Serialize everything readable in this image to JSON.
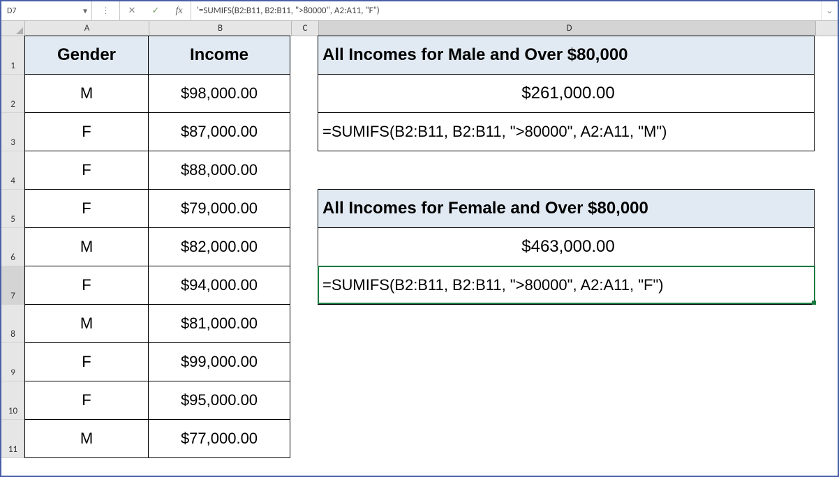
{
  "formula_bar": {
    "cell_ref": "D7",
    "cancel_glyph": "✕",
    "accept_glyph": "✓",
    "fx_label": "fx",
    "formula": "'=SUMIFS(B2:B11, B2:B11, \">80000\", A2:A11, \"F\")",
    "options_glyph": "⋮",
    "dropdown_glyph": "▾",
    "expand_glyph": "⌄"
  },
  "column_headers": {
    "A": "A",
    "B": "B",
    "C": "C",
    "D": "D"
  },
  "row_headers": [
    "1",
    "2",
    "3",
    "4",
    "5",
    "6",
    "7",
    "8",
    "9",
    "10",
    "11"
  ],
  "active_cell": "D7",
  "table_ab": {
    "header_a": "Gender",
    "header_b": "Income",
    "rows": [
      {
        "gender": "M",
        "income": "$98,000.00"
      },
      {
        "gender": "F",
        "income": "$87,000.00"
      },
      {
        "gender": "F",
        "income": "$88,000.00"
      },
      {
        "gender": "F",
        "income": "$79,000.00"
      },
      {
        "gender": "M",
        "income": "$82,000.00"
      },
      {
        "gender": "F",
        "income": "$94,000.00"
      },
      {
        "gender": "M",
        "income": "$81,000.00"
      },
      {
        "gender": "F",
        "income": "$99,000.00"
      },
      {
        "gender": "F",
        "income": "$95,000.00"
      },
      {
        "gender": "M",
        "income": "$77,000.00"
      }
    ]
  },
  "panel_d": {
    "male_title": "All Incomes for Male and Over $80,000",
    "male_value": "$261,000.00",
    "male_formula": "=SUMIFS(B2:B11, B2:B11, \">80000\", A2:A11, \"M\")",
    "female_title": "All Incomes for Female and Over $80,000",
    "female_value": "$463,000.00",
    "female_formula": "=SUMIFS(B2:B11, B2:B11, \">80000\", A2:A11, \"F\")"
  }
}
